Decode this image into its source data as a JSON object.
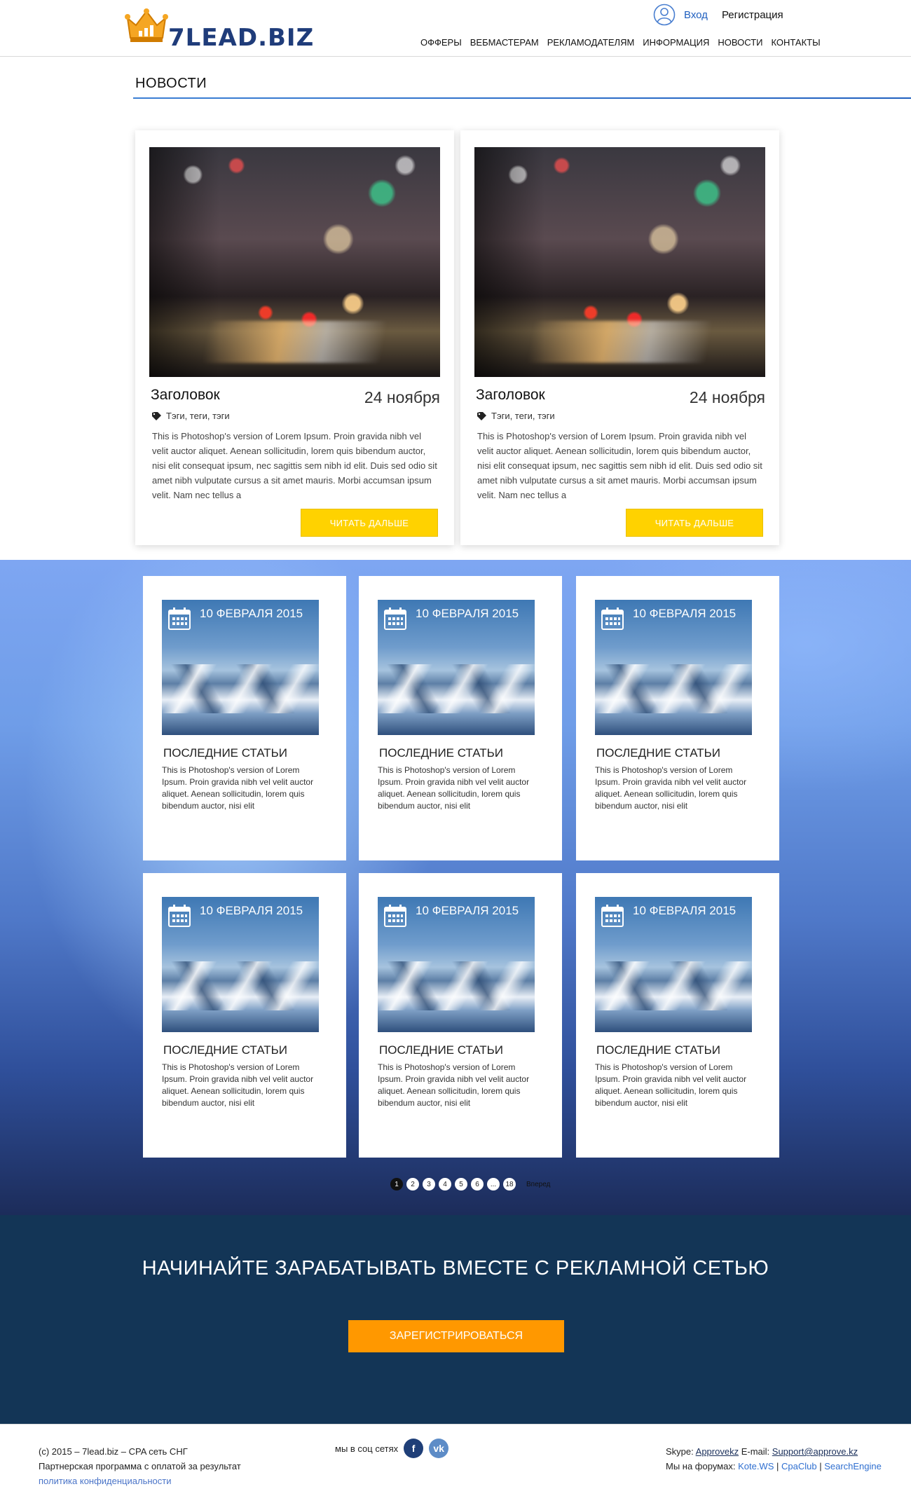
{
  "header": {
    "logo_text": "7LEAD.BIZ",
    "login": "Вход",
    "register": "Регистрация",
    "nav": [
      "ОФФЕРЫ",
      "ВЕБМАСТЕРАМ",
      "РЕКЛАМОДАТЕЛЯМ",
      "ИНФОРМАЦИЯ",
      "НОВОСТИ",
      "КОНТАКТЫ"
    ]
  },
  "news": {
    "section_title": "НОВОСТИ",
    "cards": [
      {
        "heading": "Заголовок",
        "date": "24 ноября",
        "tags": "Тэги, теги, тэги",
        "excerpt": "This is Photoshop's version  of Lorem Ipsum. Proin gravida nibh vel velit auctor aliquet. Aenean sollicitudin, lorem quis bibendum auctor, nisi elit consequat ipsum, nec sagittis sem nibh id elit. Duis sed odio sit amet nibh vulputate cursus a sit amet mauris. Morbi accumsan ipsum velit. Nam nec tellus a",
        "button": "ЧИТАТЬ ДАЛЬШЕ"
      },
      {
        "heading": "Заголовок",
        "date": "24 ноября",
        "tags": "Тэги, теги, тэги",
        "excerpt": "This is Photoshop's version  of Lorem Ipsum. Proin gravida nibh vel velit auctor aliquet. Aenean sollicitudin, lorem quis bibendum auctor, nisi elit consequat ipsum, nec sagittis sem nibh id elit. Duis sed odio sit amet nibh vulputate cursus a sit amet mauris. Morbi accumsan ipsum velit. Nam nec tellus a",
        "button": "ЧИТАТЬ ДАЛЬШЕ"
      }
    ]
  },
  "articles": [
    {
      "date": "10 ФЕВРАЛЯ 2015",
      "title": "ПОСЛЕДНИЕ СТАТЬИ",
      "text": "This is Photoshop's version  of Lorem Ipsum. Proin gravida nibh vel velit auctor aliquet. Aenean sollicitudin, lorem quis bibendum auctor, nisi elit"
    },
    {
      "date": "10 ФЕВРАЛЯ 2015",
      "title": "ПОСЛЕДНИЕ СТАТЬИ",
      "text": "This is Photoshop's version  of Lorem Ipsum. Proin gravida nibh vel velit auctor aliquet. Aenean sollicitudin, lorem quis bibendum auctor, nisi elit"
    },
    {
      "date": "10 ФЕВРАЛЯ 2015",
      "title": "ПОСЛЕДНИЕ СТАТЬИ",
      "text": "This is Photoshop's version  of Lorem Ipsum. Proin gravida nibh vel velit auctor aliquet. Aenean sollicitudin, lorem quis bibendum auctor, nisi elit"
    },
    {
      "date": "10 ФЕВРАЛЯ 2015",
      "title": "ПОСЛЕДНИЕ СТАТЬИ",
      "text": "This is Photoshop's version  of Lorem Ipsum. Proin gravida nibh vel velit auctor aliquet. Aenean sollicitudin, lorem quis bibendum auctor, nisi elit"
    },
    {
      "date": "10 ФЕВРАЛЯ 2015",
      "title": "ПОСЛЕДНИЕ СТАТЬИ",
      "text": "This is Photoshop's version  of Lorem Ipsum. Proin gravida nibh vel velit auctor aliquet. Aenean sollicitudin, lorem quis bibendum auctor, nisi elit"
    },
    {
      "date": "10 ФЕВРАЛЯ 2015",
      "title": "ПОСЛЕДНИЕ СТАТЬИ",
      "text": "This is Photoshop's version  of Lorem Ipsum. Proin gravida nibh vel velit auctor aliquet. Aenean sollicitudin, lorem quis bibendum auctor, nisi elit"
    }
  ],
  "pagination": {
    "pages": [
      "1",
      "2",
      "3",
      "4",
      "5",
      "6",
      "...",
      "18"
    ],
    "current": "1",
    "next": "Вперед"
  },
  "cta": {
    "title": "НАЧИНАЙТЕ ЗАРАБАТЫВАТЬ ВМЕСТЕ С РЕКЛАМНОЙ СЕТЬЮ",
    "button": "ЗАРЕГИСТРИРОВАТЬСЯ"
  },
  "footer": {
    "copyright": "(с) 2015 – 7lead.biz – CPA сеть СНГ",
    "tagline": "Партнерская программа с оплатой за результат",
    "policy": "политика конфиденциальности",
    "social_label": "мы в соц сетях",
    "social_icons": [
      "facebook-icon",
      "vk-icon"
    ],
    "skype_label": "Skype:",
    "skype": "Approvekz",
    "email_label": "E-mail:",
    "email": "Support@approve.kz",
    "forums_label": "Мы на форумах:",
    "forums": [
      "Kote.WS",
      "CpaClub",
      "SearchEngine"
    ]
  },
  "colors": {
    "accent_blue": "#1f5fbf",
    "button_yellow": "#ffd200",
    "cta_orange": "#ff9800",
    "cta_background": "#133556"
  }
}
